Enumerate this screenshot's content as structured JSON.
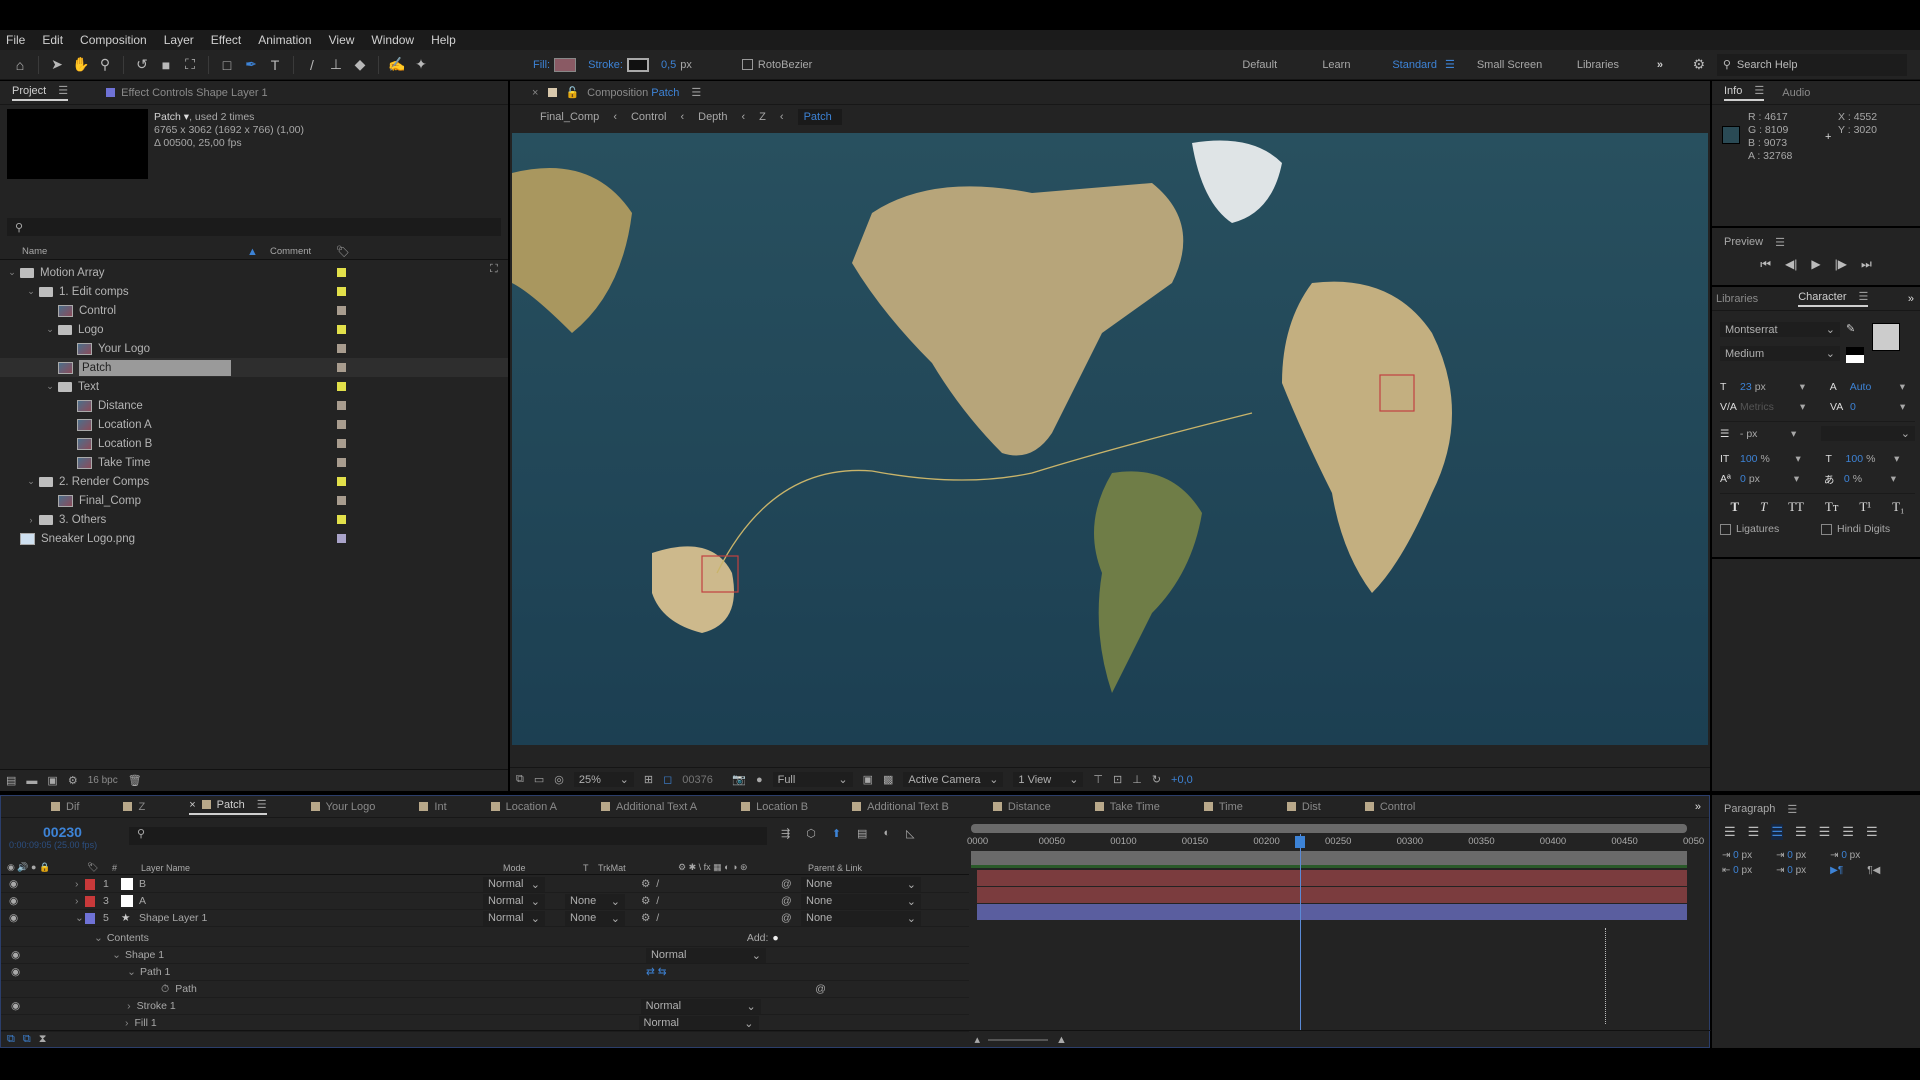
{
  "menu": [
    "File",
    "Edit",
    "Composition",
    "Layer",
    "Effect",
    "Animation",
    "View",
    "Window",
    "Help"
  ],
  "toolbar": {
    "fill_label": "Fill:",
    "stroke_label": "Stroke:",
    "stroke_width": "0,5",
    "stroke_unit": "px",
    "fill_color": "#8a5a64",
    "rotobezier": "RotoBezier",
    "workspaces": [
      "Default",
      "Learn",
      "Standard",
      "Small Screen",
      "Libraries"
    ],
    "active_workspace": "Standard",
    "search_placeholder": "Search Help"
  },
  "project": {
    "tab": "Project",
    "effect_tab": "Effect Controls Shape Layer 1",
    "item_name": "Patch",
    "used": ", used 2 times",
    "dims": "6765 x 3062  (1692 x 766) (1,00)",
    "duration": "Δ 00500, 25,00 fps",
    "col_name": "Name",
    "col_comment": "Comment",
    "bpc": "16 bpc",
    "tree": [
      {
        "label": "Motion Array",
        "type": "folder",
        "depth": 0,
        "expanded": true,
        "color": "#e2e04a"
      },
      {
        "label": "1. Edit comps",
        "type": "folder",
        "depth": 1,
        "expanded": true,
        "color": "#e2e04a"
      },
      {
        "label": "Control",
        "type": "comp",
        "depth": 2,
        "color": "#a89c8e"
      },
      {
        "label": "Logo",
        "type": "folder",
        "depth": 2,
        "expanded": true,
        "color": "#e2e04a"
      },
      {
        "label": "Your Logo",
        "type": "comp",
        "depth": 3,
        "color": "#a89c8e"
      },
      {
        "label": "Patch",
        "type": "comp",
        "depth": 2,
        "color": "#a89c8e",
        "selected": true
      },
      {
        "label": "Text",
        "type": "folder",
        "depth": 2,
        "expanded": true,
        "color": "#e2e04a"
      },
      {
        "label": "Distance",
        "type": "comp",
        "depth": 3,
        "color": "#a89c8e"
      },
      {
        "label": "Location A",
        "type": "comp",
        "depth": 3,
        "color": "#a89c8e"
      },
      {
        "label": "Location B",
        "type": "comp",
        "depth": 3,
        "color": "#a89c8e"
      },
      {
        "label": "Take Time",
        "type": "comp",
        "depth": 3,
        "color": "#a89c8e"
      },
      {
        "label": "2. Render Comps",
        "type": "folder",
        "depth": 1,
        "expanded": true,
        "color": "#e2e04a"
      },
      {
        "label": "Final_Comp",
        "type": "comp",
        "depth": 2,
        "color": "#a89c8e"
      },
      {
        "label": "3. Others",
        "type": "folder",
        "depth": 1,
        "expanded": false,
        "color": "#e2e04a"
      },
      {
        "label": "Sneaker Logo.png",
        "type": "image",
        "depth": 0,
        "color": "#a9a3c9"
      }
    ]
  },
  "composition": {
    "tab_prefix": "Composition",
    "tab_name": "Patch",
    "breadcrumbs": [
      "Final_Comp",
      "Control",
      "Depth",
      "Z",
      "Patch"
    ],
    "zoom": "25%",
    "frame": "00376",
    "resolution": "Full",
    "camera": "Active Camera",
    "views": "1 View",
    "exposure": "+0,0"
  },
  "info": {
    "tab": "Info",
    "audio_tab": "Audio",
    "r": "R : 4617",
    "g": "G : 8109",
    "b": "B : 9073",
    "a": "A : 32768",
    "x": "X : 4552",
    "y": "Y : 3020",
    "swatch": "#2a4a55"
  },
  "preview": {
    "title": "Preview"
  },
  "character": {
    "libraries_tab": "Libraries",
    "tab": "Character",
    "font": "Montserrat",
    "style": "Medium",
    "size": "23",
    "size_unit": "px",
    "leading": "Auto",
    "kerning": "Metrics",
    "tracking": "0",
    "stroke_width": "-",
    "stroke_unit": "px",
    "vscale": "100",
    "hscale": "100",
    "baseline": "0",
    "baseline_unit": "px",
    "tsume": "0",
    "pct": "%",
    "ligatures": "Ligatures",
    "hindi": "Hindi Digits"
  },
  "paragraph": {
    "title": "Paragraph",
    "indent_left": "0",
    "indent_right": "0",
    "space_before": "0",
    "space_after": "0",
    "first_indent": "0",
    "unit": "px"
  },
  "timeline": {
    "tabs": [
      "Dif",
      "Z",
      "Patch",
      "Your Logo",
      "Int",
      "Location A",
      "Additional Text A",
      "Location B",
      "Additional Text B",
      "Distance",
      "Take Time",
      "Time",
      "Dist",
      "Control"
    ],
    "active_tab": "Patch",
    "current_time": "00230",
    "time_sub": "0:00:09:05 (25.00 fps)",
    "col_headers": {
      "layer_name": "Layer Name",
      "mode": "Mode",
      "t": "T",
      "trkmat": "TrkMat",
      "parent": "Parent & Link"
    },
    "ruler": [
      "0000",
      "00050",
      "00100",
      "00150",
      "00200",
      "00250",
      "00300",
      "00350",
      "00400",
      "00450",
      "0050"
    ],
    "playhead_fraction": 0.46,
    "layers": [
      {
        "num": "1",
        "name": "B",
        "mode": "Normal",
        "trkmat": "",
        "parent": "None",
        "label": "#c8393a",
        "icon": "solid"
      },
      {
        "num": "3",
        "name": "A",
        "mode": "Normal",
        "trkmat": "None",
        "parent": "None",
        "label": "#c8393a",
        "icon": "solid"
      },
      {
        "num": "5",
        "name": "Shape Layer 1",
        "mode": "Normal",
        "trkmat": "None",
        "parent": "None",
        "label": "#6f72d6",
        "icon": "star"
      }
    ],
    "contents": {
      "contents": "Contents",
      "add": "Add:",
      "shape": "Shape 1",
      "shape_mode": "Normal",
      "path_group": "Path 1",
      "path": "Path",
      "stroke": "Stroke 1",
      "stroke_mode": "Normal",
      "fill": "Fill 1",
      "fill_mode": "Normal"
    }
  }
}
